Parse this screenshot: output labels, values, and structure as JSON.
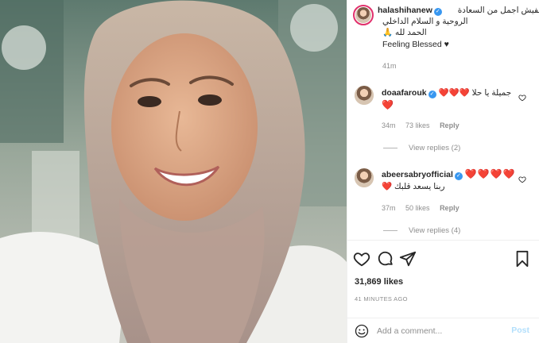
{
  "post": {
    "author": "halashihanew",
    "caption_lines": [
      "مفيش اجمل من السعادة",
      "الروحية و السلام الداخلي",
      "الحمد لله 🙏",
      "Feeling Blessed ♥"
    ],
    "caption_time": "41m"
  },
  "comments": [
    {
      "username": "doaafarouk",
      "text_lines": [
        "جميلة يا حلا ❤️❤️❤️",
        "❤️"
      ],
      "time": "34m",
      "likes": "73 likes",
      "reply_label": "Reply",
      "view_replies": "View replies (2)"
    },
    {
      "username": "abeersabryofficial",
      "text_lines": [
        "❤️❤️❤️❤️",
        "ربنا يسعد قلبك ❤️"
      ],
      "time": "37m",
      "likes": "50 likes",
      "reply_label": "Reply",
      "view_replies": "View replies (4)"
    }
  ],
  "stats": {
    "likes": "31,869 likes",
    "posted": "41 MINUTES AGO"
  },
  "composer": {
    "placeholder": "Add a comment...",
    "post_label": "Post"
  },
  "icons": {
    "like": "heart-icon",
    "comment": "comment-icon",
    "share": "paper-plane-icon",
    "save": "bookmark-icon",
    "emoji": "emoji-icon",
    "verified": "verified-badge-icon"
  },
  "colors": {
    "verified": "#3897f0",
    "heart": "#ed4956",
    "muted": "#8e8e8e",
    "post_disabled": "#b2dffc"
  }
}
